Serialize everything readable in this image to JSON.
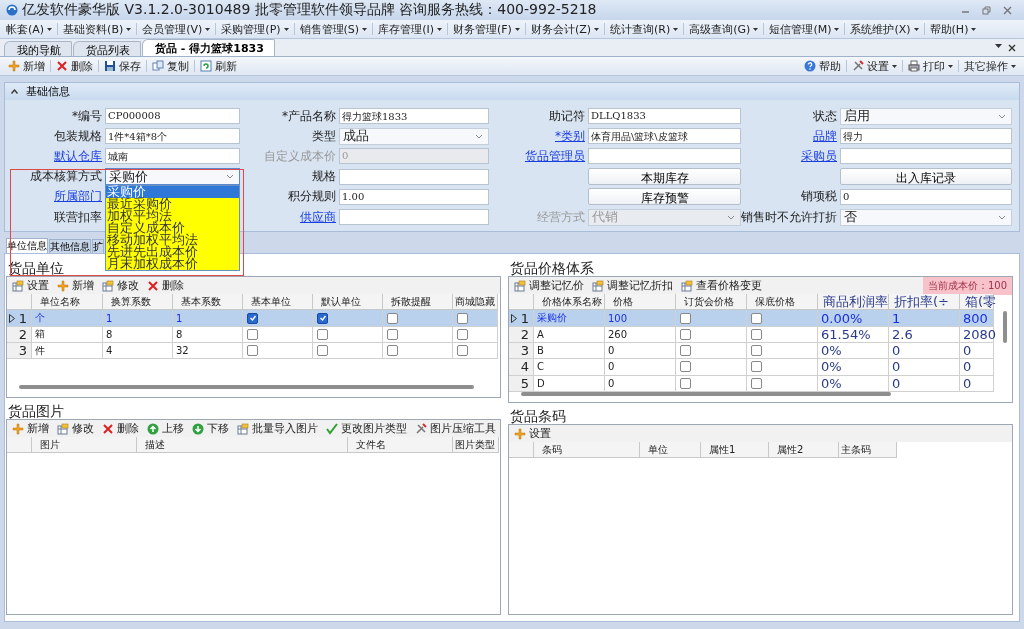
{
  "window": {
    "title": "亿发软件豪华版 V3.1.2.0-3010489 批零管理软件领导品牌 咨询服务热线：400-992-5218"
  },
  "menu": [
    {
      "label": "帐套(A)"
    },
    {
      "label": "基础资料(B)"
    },
    {
      "label": "会员管理(V)"
    },
    {
      "label": "采购管理(P)"
    },
    {
      "label": "销售管理(S)"
    },
    {
      "label": "库存管理(I)"
    },
    {
      "label": "财务管理(F)"
    },
    {
      "label": "财务会计(Z)"
    },
    {
      "label": "统计查询(R)"
    },
    {
      "label": "高级查询(G)"
    },
    {
      "label": "短信管理(M)"
    },
    {
      "label": "系统维护(X)"
    },
    {
      "label": "帮助(H)"
    }
  ],
  "doc_tabs": [
    {
      "label": "我的导航",
      "selected": false
    },
    {
      "label": "货品列表",
      "selected": false
    },
    {
      "label": "货品 - 得力篮球1833",
      "selected": true
    }
  ],
  "toolbar": {
    "left": [
      {
        "kind": "add",
        "label": "新增"
      },
      {
        "kind": "delete",
        "label": "删除"
      },
      {
        "kind": "save",
        "label": "保存"
      },
      {
        "kind": "copy",
        "label": "复制"
      },
      {
        "kind": "refresh",
        "label": "刷新"
      }
    ],
    "right": [
      {
        "kind": "help",
        "label": "帮助",
        "dropdown": false
      },
      {
        "kind": "tools",
        "label": "设置",
        "dropdown": true
      },
      {
        "kind": "print",
        "label": "打印",
        "dropdown": true
      },
      {
        "kind": "none",
        "label": "其它操作",
        "dropdown": true
      }
    ]
  },
  "section": {
    "title": "基础信息",
    "expanded": true
  },
  "form": {
    "rows": [
      [
        {
          "label": "*编号",
          "link": false,
          "disabled": false,
          "field": {
            "kind": "text",
            "value": "CP000008"
          }
        },
        {
          "label": "*产品名称",
          "link": false,
          "disabled": false,
          "field": {
            "kind": "text",
            "value": "得力篮球1833"
          }
        },
        {
          "label": "助记符",
          "link": false,
          "disabled": false,
          "field": {
            "kind": "text",
            "value": "DLLQ1833"
          }
        },
        {
          "label": "状态",
          "link": false,
          "disabled": false,
          "field": {
            "kind": "select",
            "value": "启用",
            "open": false
          }
        }
      ],
      [
        {
          "label": "包装规格",
          "link": false,
          "disabled": false,
          "field": {
            "kind": "text",
            "value": "1件*4箱*8个"
          }
        },
        {
          "label": "类型",
          "link": false,
          "disabled": false,
          "field": {
            "kind": "select",
            "value": "成品",
            "open": false
          }
        },
        {
          "label": "*类别",
          "link": true,
          "disabled": false,
          "field": {
            "kind": "text",
            "value": "体育用品\\篮球\\皮篮球"
          }
        },
        {
          "label": "品牌",
          "link": true,
          "disabled": false,
          "field": {
            "kind": "text",
            "value": "得力"
          }
        }
      ],
      [
        {
          "label": "默认仓库",
          "link": true,
          "disabled": false,
          "field": {
            "kind": "text",
            "value": "城南"
          }
        },
        {
          "label": "自定义成本价",
          "link": false,
          "disabled": true,
          "field": {
            "kind": "text",
            "value": "0"
          }
        },
        {
          "label": "货品管理员",
          "link": true,
          "disabled": false,
          "field": {
            "kind": "text"
          }
        },
        {
          "label": "采购员",
          "link": true,
          "disabled": false,
          "field": {
            "kind": "text"
          }
        }
      ],
      [
        {
          "label": "成本核算方式",
          "link": false,
          "disabled": false,
          "field": {
            "kind": "select",
            "value": "采购价",
            "open": true
          }
        },
        {
          "label": "规格",
          "link": false,
          "disabled": false,
          "field": {
            "kind": "text"
          }
        },
        {
          "disabled": false,
          "field": {
            "kind": "button",
            "value": "本期库存"
          }
        },
        {
          "disabled": false,
          "field": {
            "kind": "button",
            "value": "出入库记录"
          }
        }
      ],
      [
        {
          "label": "所属部门",
          "link": true,
          "disabled": false
        },
        {
          "label": "积分规则",
          "link": false,
          "disabled": false,
          "field": {
            "kind": "text",
            "value": "1.00"
          }
        },
        {
          "disabled": false,
          "field": {
            "kind": "button",
            "value": "库存预警"
          }
        },
        {
          "label": "销项税",
          "link": false,
          "disabled": false,
          "field": {
            "kind": "text",
            "value": "0"
          }
        }
      ],
      [
        {
          "label": "联营扣率",
          "link": false,
          "disabled": false
        },
        {
          "label": "供应商",
          "link": true,
          "disabled": false,
          "field": {
            "kind": "text"
          }
        },
        {
          "label": "经营方式",
          "link": false,
          "disabled": true,
          "field": {
            "kind": "select",
            "value": "代销",
            "open": false
          }
        },
        {
          "label": "销售时不允许打折",
          "link": false,
          "disabled": false,
          "field": {
            "kind": "select",
            "value": "否",
            "open": false
          }
        }
      ]
    ]
  },
  "cost_dropdown": {
    "options": [
      {
        "label": "采购价",
        "selected": true
      },
      {
        "label": "最近采购价",
        "selected": false
      },
      {
        "label": "加权平均法",
        "selected": false
      },
      {
        "label": "自定义成本价",
        "selected": false
      },
      {
        "label": "移动加权平均法",
        "selected": false
      },
      {
        "label": "先进先出成本价",
        "selected": false
      },
      {
        "label": "月末加权成本价",
        "selected": false
      }
    ]
  },
  "highlight": {
    "kind": "frame"
  },
  "sub_tabs": [
    {
      "label": "单位信息",
      "selected": true
    },
    {
      "label": "其他信息",
      "selected": false
    },
    {
      "label": "扩",
      "selected": false
    }
  ],
  "left": [
    {
      "title": "货品单位",
      "toolbar": [
        {
          "kind": "table",
          "label": "设置"
        },
        {
          "kind": "add",
          "label": "新增"
        },
        {
          "kind": "table",
          "label": "修改"
        },
        {
          "kind": "delete",
          "label": "删除"
        }
      ],
      "columns": [
        {
          "label": "单位名称",
          "kind": "text"
        },
        {
          "label": "换算系数",
          "kind": "text"
        },
        {
          "label": "基本系数",
          "kind": "text"
        },
        {
          "label": "基本单位",
          "kind": "check"
        },
        {
          "label": "默认单位",
          "kind": "check"
        },
        {
          "label": "拆散提醒",
          "kind": "check"
        },
        {
          "label": "商城隐藏",
          "kind": "check"
        }
      ],
      "rows": [
        {
          "num": "1",
          "selected": true,
          "cells": [
            "个",
            "1",
            "1",
            true,
            true,
            false,
            false
          ]
        },
        {
          "num": "2",
          "selected": false,
          "cells": [
            "箱",
            "8",
            "8",
            false,
            false,
            false,
            false
          ]
        },
        {
          "num": "3",
          "selected": false,
          "cells": [
            "件",
            "4",
            "32",
            false,
            false,
            false,
            false
          ]
        }
      ]
    },
    {
      "title": "货品图片",
      "toolbar": [
        {
          "kind": "add",
          "label": "新增"
        },
        {
          "kind": "table",
          "label": "修改"
        },
        {
          "kind": "delete",
          "label": "删除"
        },
        {
          "kind": "up",
          "label": "上移"
        },
        {
          "kind": "down",
          "label": "下移"
        },
        {
          "kind": "table",
          "label": "批量导入图片"
        },
        {
          "kind": "check",
          "label": "更改图片类型"
        },
        {
          "kind": "tools",
          "label": "图片压缩工具"
        }
      ],
      "columns": [
        {
          "label": "图片",
          "kind": "text"
        },
        {
          "label": "描述",
          "kind": "text"
        },
        {
          "label": "文件名",
          "kind": "text"
        },
        {
          "label": "图片类型",
          "kind": "text"
        }
      ]
    }
  ],
  "right": [
    {
      "title": "货品价格体系",
      "toolbar": [
        {
          "kind": "table",
          "label": "调整记忆价"
        },
        {
          "kind": "table",
          "label": "调整记忆折扣"
        },
        {
          "kind": "table",
          "label": "查看价格变更"
        }
      ],
      "note": "当前成本价：100",
      "columns": [
        {
          "label": "价格体系名称",
          "kind": "text"
        },
        {
          "label": "价格",
          "kind": "text"
        },
        {
          "label": "订货会价格",
          "kind": "check"
        },
        {
          "label": "保底价格",
          "kind": "check"
        },
        {
          "label": "商品利润率",
          "kind": "big"
        },
        {
          "label": "折扣率(÷",
          "kind": "big"
        },
        {
          "label": "箱(零",
          "kind": "big"
        }
      ],
      "rows": [
        {
          "num": "1",
          "selected": true,
          "cells": [
            "采购价",
            "100",
            false,
            false,
            "0.00%",
            "1",
            "800"
          ]
        },
        {
          "num": "2",
          "selected": false,
          "cells": [
            "A",
            "260",
            false,
            false,
            "61.54%",
            "2.6",
            "2080"
          ]
        },
        {
          "num": "3",
          "selected": false,
          "cells": [
            "B",
            "0",
            false,
            false,
            "0%",
            "0",
            "0"
          ]
        },
        {
          "num": "4",
          "selected": false,
          "cells": [
            "C",
            "0",
            false,
            false,
            "0%",
            "0",
            "0"
          ]
        },
        {
          "num": "5",
          "selected": false,
          "cells": [
            "D",
            "0",
            false,
            false,
            "0%",
            "0",
            "0"
          ]
        }
      ]
    },
    {
      "title": "货品条码",
      "toolbar": [
        {
          "kind": "add",
          "label": "设置"
        }
      ],
      "columns": [
        {
          "label": "条码",
          "kind": "text"
        },
        {
          "label": "单位",
          "kind": "text"
        },
        {
          "label": "属性1",
          "kind": "text"
        },
        {
          "label": "属性2",
          "kind": "text"
        },
        {
          "label": "主条码",
          "kind": "text"
        }
      ]
    }
  ]
}
